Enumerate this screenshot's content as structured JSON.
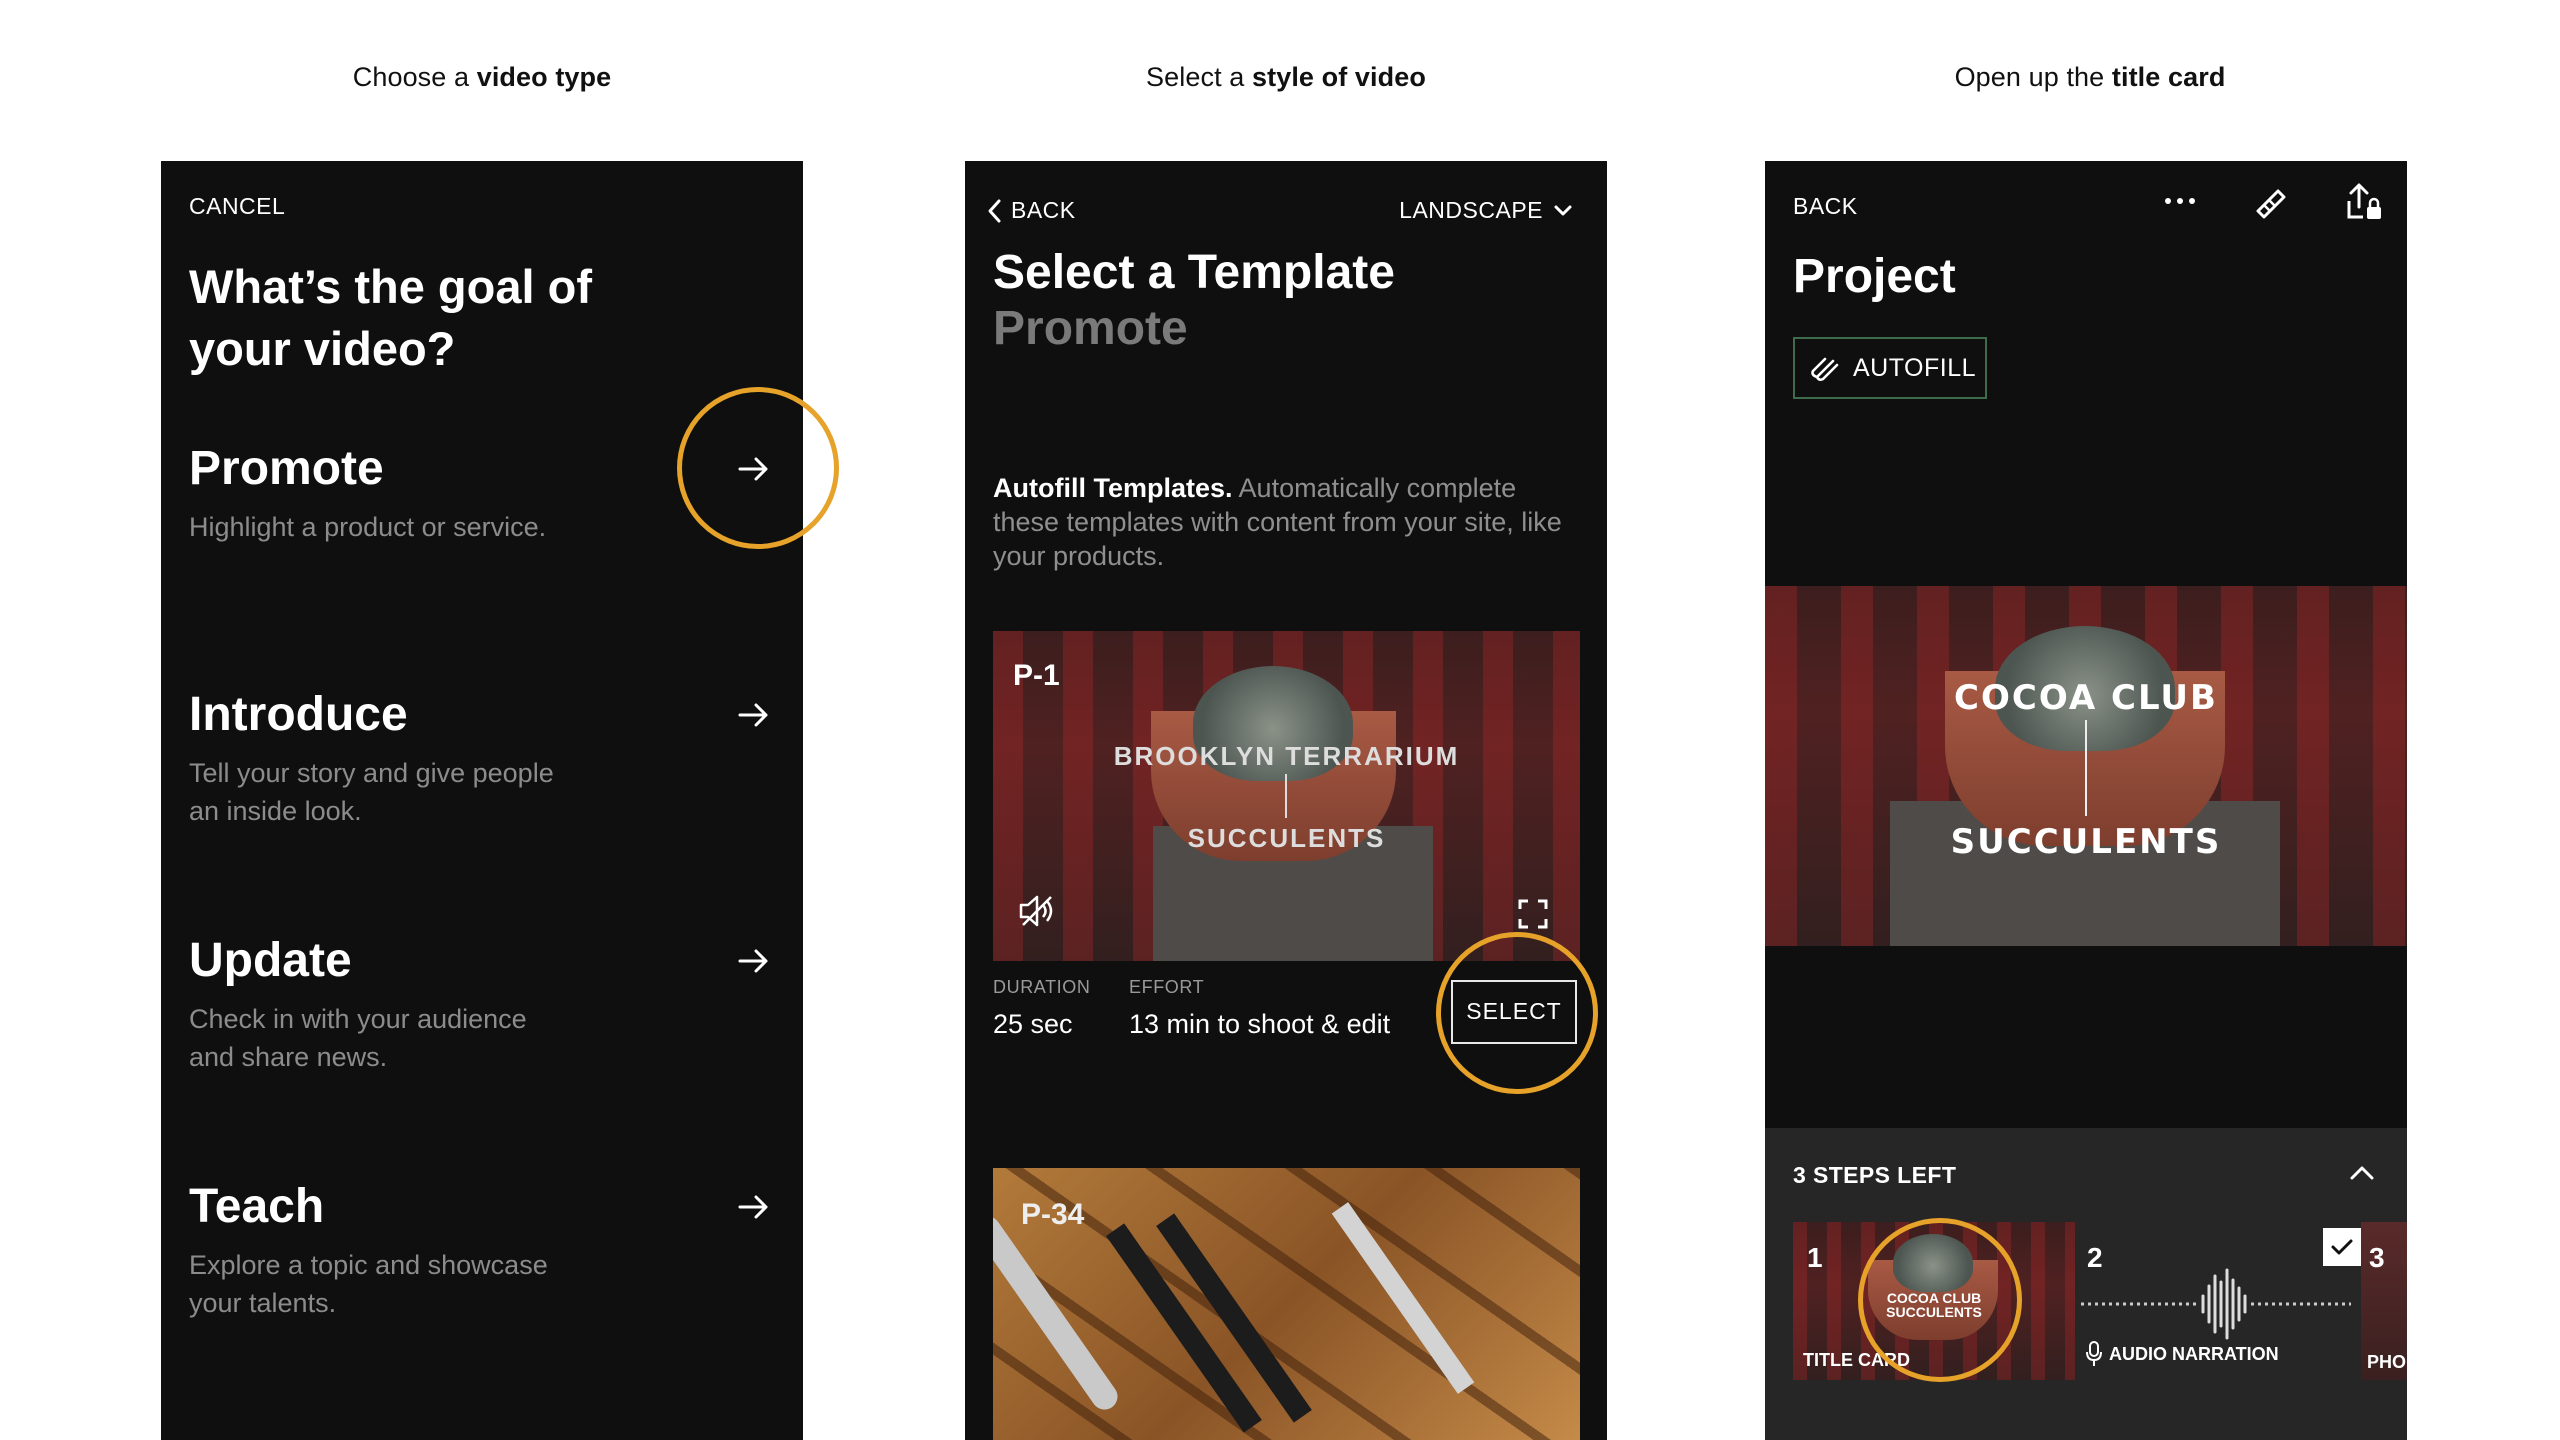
{
  "captions": [
    {
      "pre": "Choose a ",
      "bold": "video type"
    },
    {
      "pre": "Select a ",
      "bold": "style of video"
    },
    {
      "pre": "Open up the ",
      "bold": "title card"
    }
  ],
  "screen1": {
    "cancel": "CANCEL",
    "heading": "What’s the goal of your video?",
    "options": [
      {
        "title": "Promote",
        "desc": "Highlight a product or service."
      },
      {
        "title": "Introduce",
        "desc": "Tell your story and give people an inside look."
      },
      {
        "title": "Update",
        "desc": "Check in with your audience and share news."
      },
      {
        "title": "Teach",
        "desc": "Explore a topic and showcase your talents."
      }
    ]
  },
  "screen2": {
    "back": "BACK",
    "orientation": "LANDSCAPE",
    "title": "Select a Template",
    "subtitle": "Promote",
    "info_bold": "Autofill Templates.",
    "info_rest": " Automatically complete these templates with content from your site, like your products.",
    "template1": {
      "id": "P-1",
      "line1": "BROOKLYN TERRARIUM",
      "line2": "SUCCULENTS",
      "duration_label": "DURATION",
      "duration": "25 sec",
      "effort_label": "EFFORT",
      "effort": "13 min to shoot & edit",
      "select": "SELECT"
    },
    "template2": {
      "id": "P-34"
    }
  },
  "screen3": {
    "back": "BACK",
    "title": "Project",
    "autofill": "AUTOFILL",
    "card_line1": "COCOA CLUB",
    "card_line2": "SUCCULENTS",
    "steps_left": "3 STEPS LEFT",
    "steps": [
      {
        "num": "1",
        "label": "TITLE CARD",
        "mini1": "COCOA CLUB",
        "mini2": "SUCCULENTS"
      },
      {
        "num": "2",
        "label": "AUDIO NARRATION"
      },
      {
        "num": "3",
        "label": "PHO"
      }
    ]
  },
  "colors": {
    "accent_ring": "#e6a229",
    "phone_bg": "#0f0f0f",
    "autofill_border": "#3e6b4c"
  }
}
